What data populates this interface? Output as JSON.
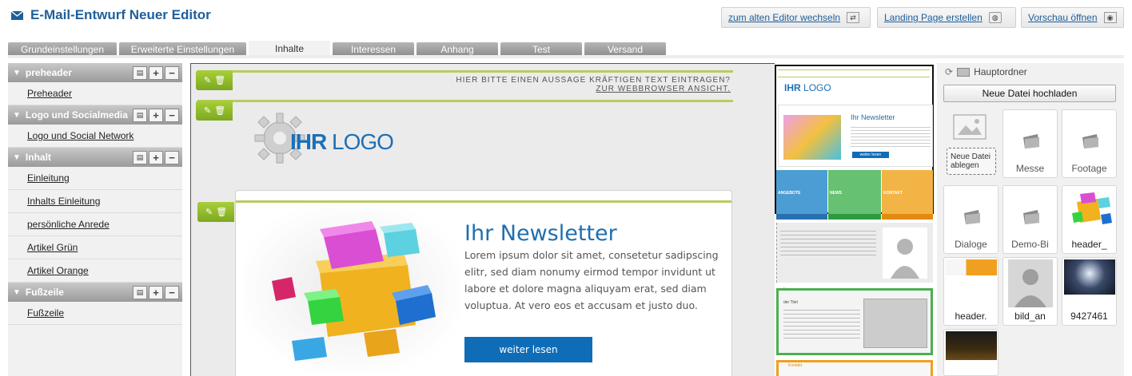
{
  "header": {
    "title": "E-Mail-Entwurf Neuer Editor",
    "buttons": {
      "old_editor": "zum alten Editor wechseln",
      "landing_page": "Landing Page erstellen",
      "preview": "Vorschau öffnen"
    }
  },
  "tabs": [
    {
      "label": "Grundeinstellungen"
    },
    {
      "label": "Erweiterte Einstellungen"
    },
    {
      "label": "Inhalte"
    },
    {
      "label": "Interessen"
    },
    {
      "label": "Anhang"
    },
    {
      "label": "Test"
    },
    {
      "label": "Versand"
    }
  ],
  "active_tab": "Inhalte",
  "sidebar": {
    "groups": [
      {
        "title": "preheader",
        "items": [
          "Preheader"
        ]
      },
      {
        "title": "Logo und Socialmedia",
        "items": [
          "Logo und Social Network"
        ]
      },
      {
        "title": "Inhalt",
        "items": [
          "Einleitung",
          "Inhalts Einleitung",
          "persönliche Anrede",
          "Artikel Grün",
          "Artikel Orange"
        ]
      },
      {
        "title": "Fußzeile",
        "items": [
          "Fußzeile"
        ]
      }
    ]
  },
  "editor": {
    "preheader_line1": "HIER BITTE EINEN AUSSAGE KRÄFTIGEN TEXT EINTRAGEN?",
    "preheader_line2": "ZUR WEBBROWSER ANSICHT.",
    "logo_bold": "IHR",
    "logo_light": "LOGO",
    "newsletter_title": "Ihr Newsletter",
    "newsletter_body": "Lorem ipsum dolor sit amet, consetetur sadipscing elitr, sed diam nonumy eirmod tempor invidunt ut labore et dolore magna aliquyam erat, sed diam voluptua. At vero eos et accusam et justo duo.",
    "read_more": "weiter lesen"
  },
  "preview": {
    "logo_bold": "IHR",
    "logo_light": "LOGO",
    "title": "Ihr Newsletter",
    "read_more": "weiter lesen",
    "tiles": [
      "ANGEBOTE",
      "NEWS",
      "KONTAKT"
    ],
    "section_news": "News",
    "section_contact": "Kontakt",
    "news_title": "der Titel"
  },
  "media": {
    "folder": "Hauptordner",
    "upload": "Neue Datei hochladen",
    "drop_line1": "Neue Datei",
    "drop_line2": "ablegen",
    "items": [
      "Messe",
      "Footage",
      "Dialoge",
      "Demo-Bi",
      "header_",
      "header.",
      "bild_an",
      "9427461"
    ]
  },
  "colors": {
    "brand_blue": "#1f5f9a",
    "edit_green": "#8cbb2a",
    "tab_gray": "#9e9e9e",
    "button_blue": "#0f6cb6"
  }
}
